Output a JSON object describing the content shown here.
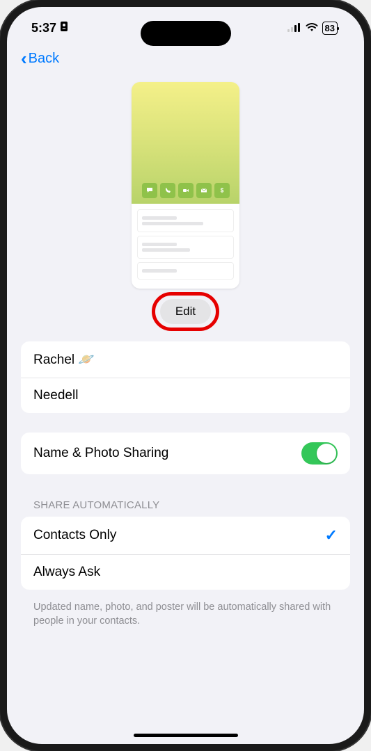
{
  "status": {
    "time": "5:37",
    "battery": "83"
  },
  "nav": {
    "back": "Back"
  },
  "edit": {
    "label": "Edit"
  },
  "name": {
    "first": "Rachel 🪐",
    "last": "Needell"
  },
  "sharing": {
    "label": "Name & Photo Sharing",
    "on": true
  },
  "auto": {
    "header": "SHARE AUTOMATICALLY",
    "option1": "Contacts Only",
    "option2": "Always Ask",
    "footer": "Updated name, photo, and poster will be automatically shared with people in your contacts."
  }
}
